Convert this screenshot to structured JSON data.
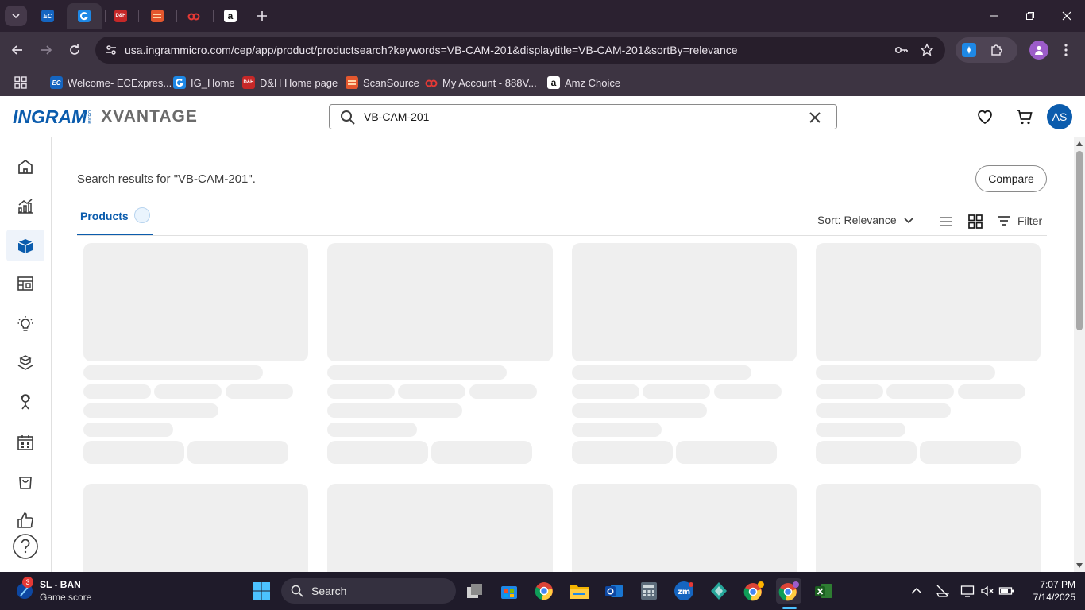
{
  "browser": {
    "tabs": [
      {
        "favicon_text": "EC",
        "active": false
      },
      {
        "favicon_text": "",
        "active": true
      },
      {
        "favicon_text": "D&H",
        "active": false
      },
      {
        "favicon_text": "",
        "active": false
      },
      {
        "favicon_text": "",
        "active": false
      },
      {
        "favicon_text": "a",
        "active": false
      }
    ],
    "url": "usa.ingrammicro.com/cep/app/product/productsearch?keywords=VB-CAM-201&displaytitle=VB-CAM-201&sortBy=relevance",
    "bookmarks": [
      {
        "label": "Welcome- ECExpres..."
      },
      {
        "label": "IG_Home"
      },
      {
        "label": "D&H Home page"
      },
      {
        "label": "ScanSource"
      },
      {
        "label": "My Account - 888V..."
      },
      {
        "label": "Amz Choice"
      }
    ]
  },
  "header": {
    "logo_ingram": "INGRAM",
    "logo_micro": "MICRO",
    "logo_xvantage": "XVANTAGE",
    "search_value": "VB-CAM-201",
    "avatar_initials": "AS"
  },
  "main": {
    "results_title": "Search results for \"VB-CAM-201\".",
    "compare_label": "Compare",
    "tab_products": "Products",
    "sort_label": "Sort: Relevance",
    "filter_label": "Filter"
  },
  "taskbar": {
    "widget_title": "SL - BAN",
    "widget_subtitle": "Game score",
    "widget_badge": "3",
    "search_label": "Search",
    "time": "7:07 PM",
    "date": "7/14/2025"
  },
  "colors": {
    "brand_blue": "#0b5cad",
    "skeleton": "#efefef",
    "chrome_frame": "#2b2130",
    "chrome_toolbar": "#3d3442"
  }
}
